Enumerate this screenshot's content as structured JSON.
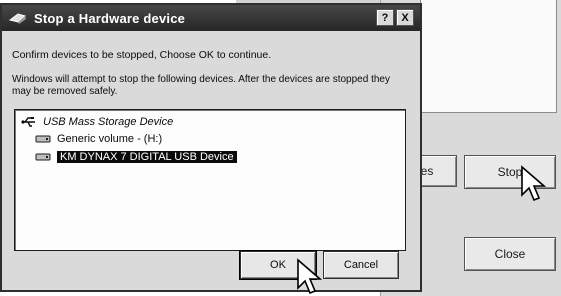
{
  "dialog": {
    "title": "Stop a Hardware device",
    "help_btn": "?",
    "close_btn": "X",
    "message1": "Confirm devices to be stopped, Choose OK to continue.",
    "message2": "Windows will attempt to stop the following devices. After the devices are stopped they may be removed safely.",
    "devices": [
      {
        "label": "USB Mass Storage Device",
        "icon": "usb-icon"
      },
      {
        "label": "Generic volume - (H:)",
        "icon": "drive-icon"
      },
      {
        "label": "KM DYNAX 7 DIGITAL USB Device",
        "icon": "drive-icon",
        "selected": true
      }
    ],
    "ok_label": "OK",
    "cancel_label": "Cancel"
  },
  "background_window": {
    "partial_button_label": "ies",
    "stop_label": "Stop",
    "close_label": "Close"
  }
}
